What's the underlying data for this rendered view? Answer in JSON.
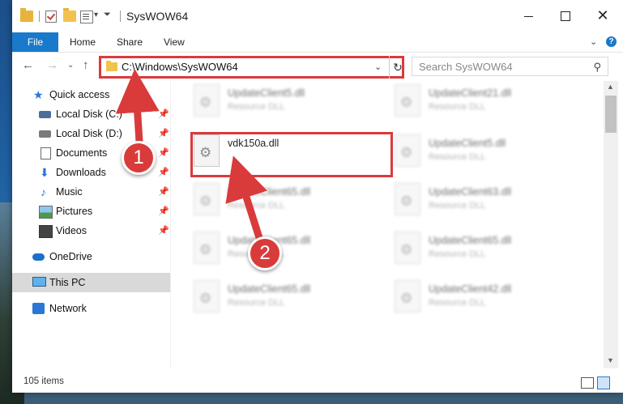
{
  "window": {
    "title": "SysWOW64",
    "min_label": "",
    "close_label": "✕"
  },
  "ribbon": {
    "tabs": [
      {
        "label": "File"
      },
      {
        "label": "Home"
      },
      {
        "label": "Share"
      },
      {
        "label": "View"
      }
    ]
  },
  "address": {
    "path": "C:\\Windows\\SysWOW64"
  },
  "search": {
    "placeholder": "Search SysWOW64"
  },
  "nav": {
    "items": [
      {
        "label": "Quick access",
        "icon": "star-icon"
      },
      {
        "label": "Local Disk (C:)",
        "icon": "drive-icon"
      },
      {
        "label": "Local Disk (D:)",
        "icon": "drive-icon"
      },
      {
        "label": "Documents",
        "icon": "documents-icon"
      },
      {
        "label": "Downloads",
        "icon": "downloads-icon"
      },
      {
        "label": "Music",
        "icon": "music-icon"
      },
      {
        "label": "Pictures",
        "icon": "pictures-icon"
      },
      {
        "label": "Videos",
        "icon": "videos-icon"
      },
      {
        "label": "OneDrive",
        "icon": "onedrive-icon"
      },
      {
        "label": "This PC",
        "icon": "pc-icon"
      },
      {
        "label": "Network",
        "icon": "network-icon"
      }
    ]
  },
  "files": {
    "left": [
      {
        "name": "UpdateClient5.dll",
        "type": "Resource DLL"
      },
      {
        "name": "vdk150a.dll",
        "type": ""
      },
      {
        "name": "UpdateClient65.dll",
        "type": "Resource DLL"
      },
      {
        "name": "UpdateClient65.dll",
        "type": "Resource DLL"
      },
      {
        "name": "UpdateClient65.dll",
        "type": "Resource DLL"
      }
    ],
    "right": [
      {
        "name": "UpdateClient21.dll",
        "type": "Resource DLL"
      },
      {
        "name": "UpdateClient5.dll",
        "type": "Resource DLL"
      },
      {
        "name": "UpdateClient63.dll",
        "type": "Resource DLL"
      },
      {
        "name": "UpdateClient65.dll",
        "type": "Resource DLL"
      },
      {
        "name": "UpdateClient42.dll",
        "type": "Resource DLL"
      }
    ]
  },
  "status": {
    "item_count": "105 items"
  },
  "annotations": {
    "step1": "1",
    "step2": "2",
    "color": "#d93b3b"
  }
}
